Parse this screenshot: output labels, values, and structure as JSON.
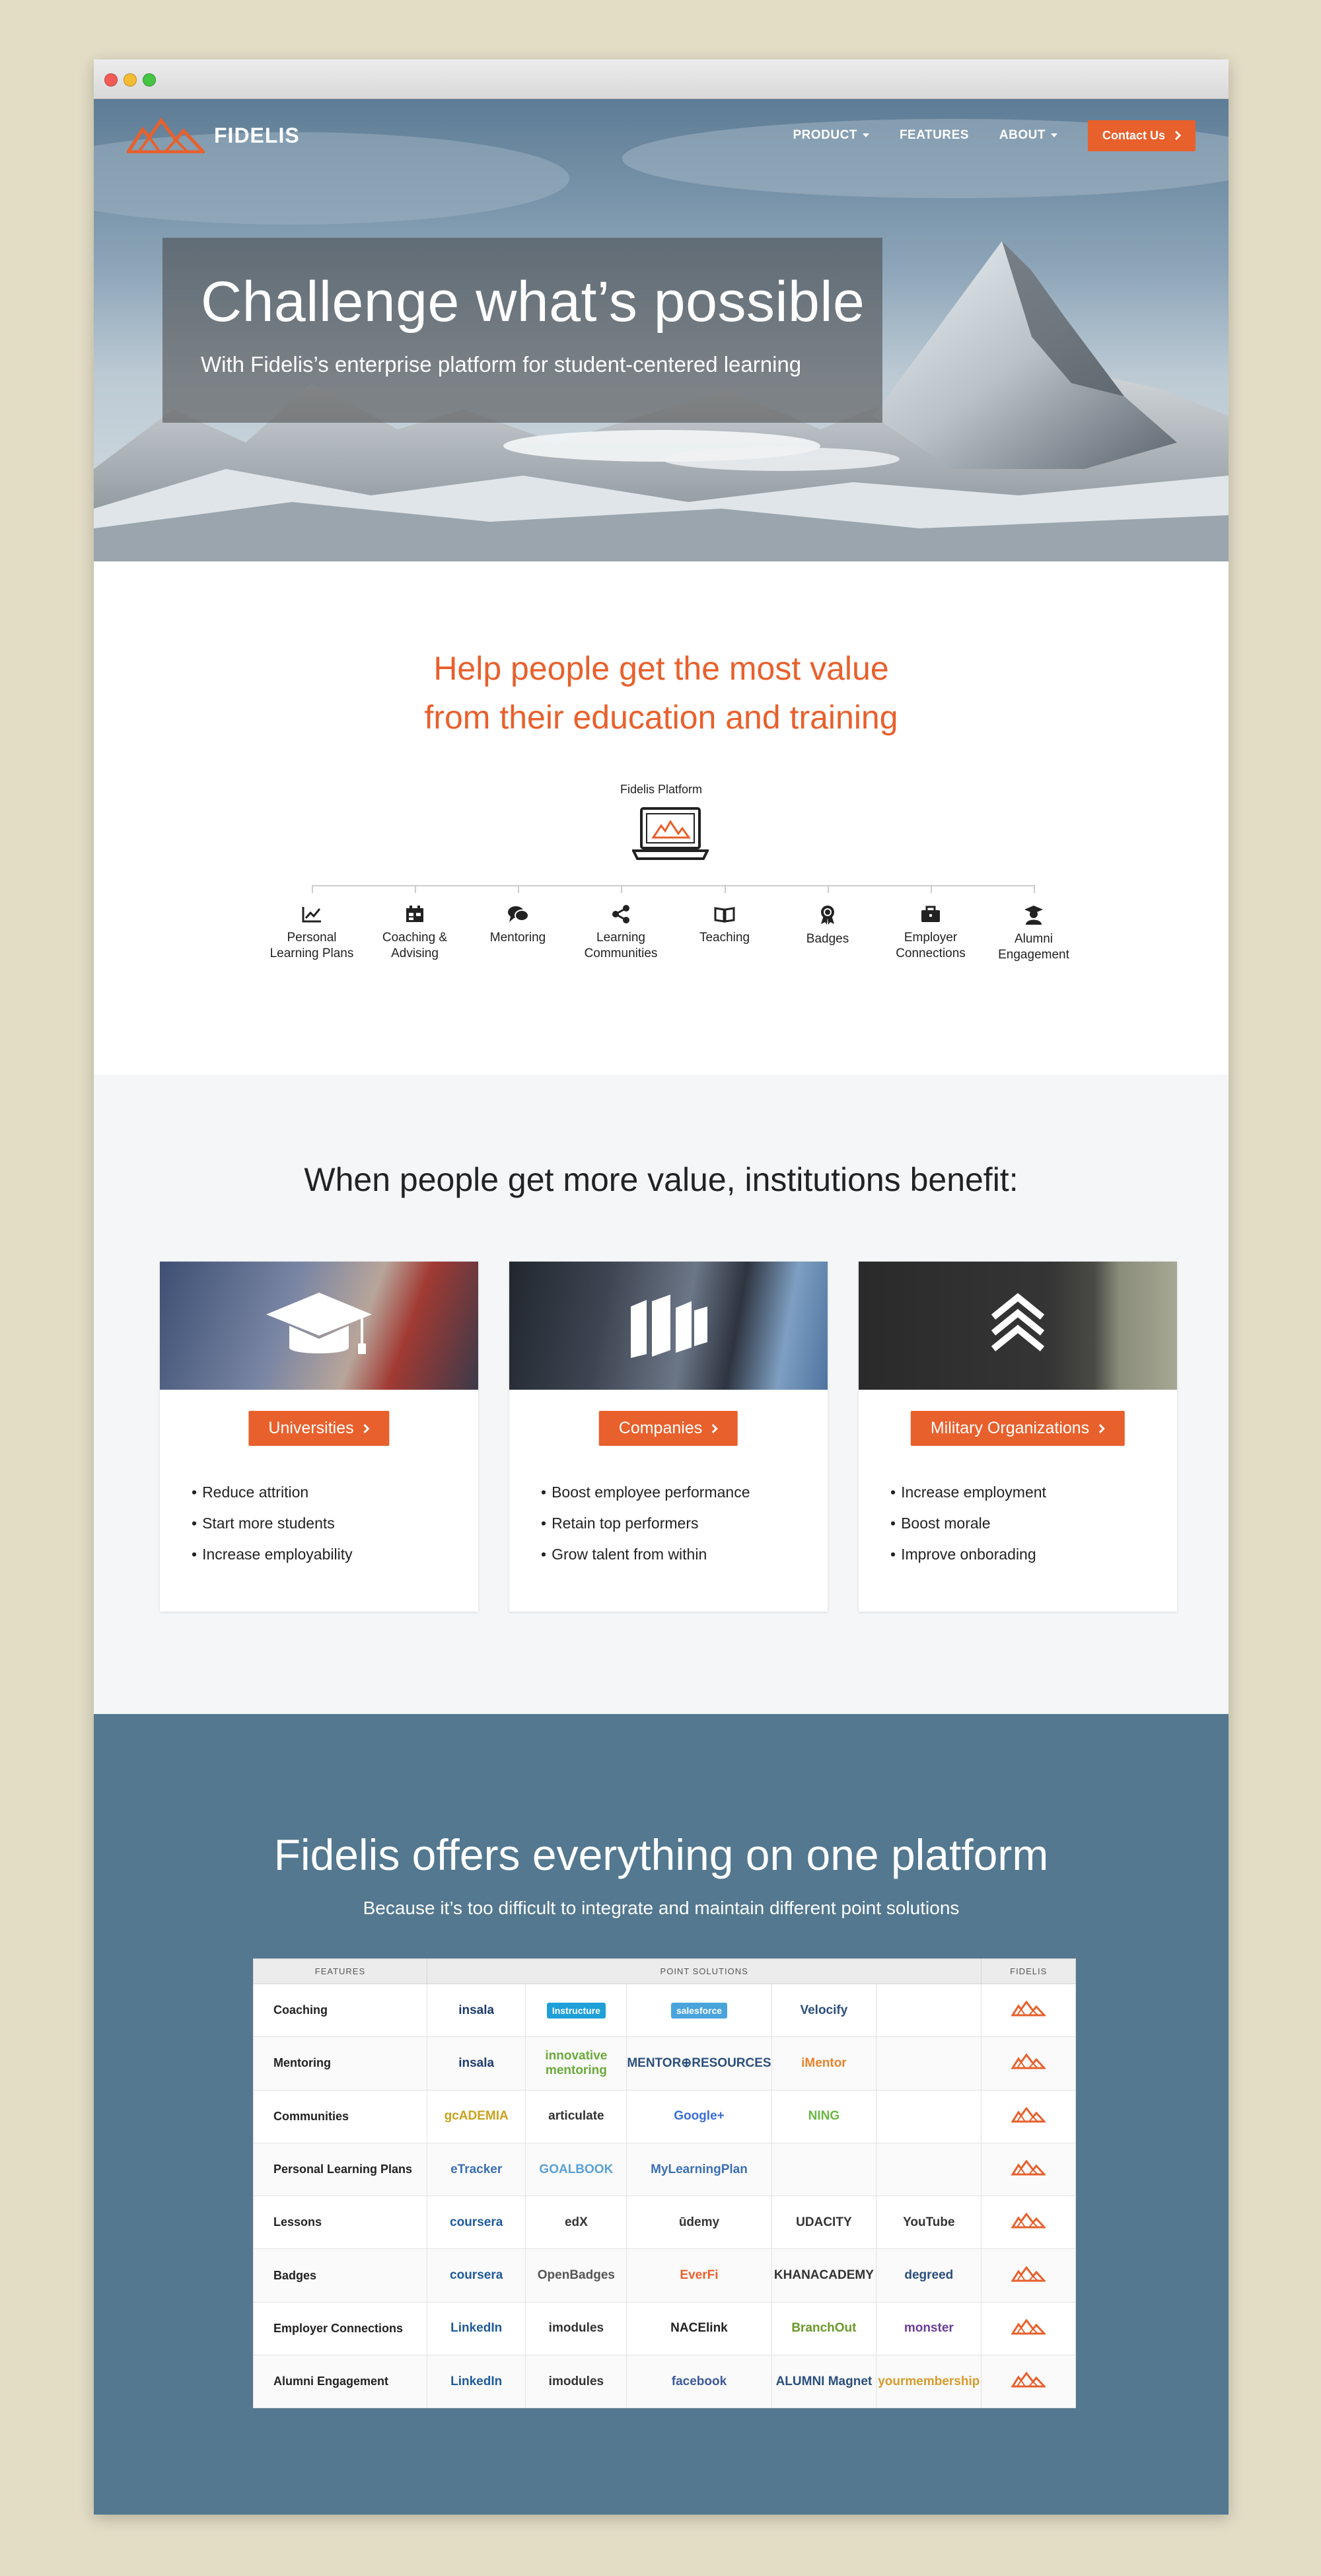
{
  "brand": {
    "name": "FIDELIS",
    "accent": "#e8602c",
    "blue": "#537890"
  },
  "nav": {
    "items": [
      {
        "label": "PRODUCT",
        "dropdown": true
      },
      {
        "label": "FEATURES",
        "dropdown": false
      },
      {
        "label": "ABOUT",
        "dropdown": true
      }
    ],
    "contact_label": "Contact Us"
  },
  "hero": {
    "title": "Challenge what’s possible",
    "subtitle": "With Fidelis’s enterprise platform for student-centered learning"
  },
  "value": {
    "title_line1": "Help people get the most value",
    "title_line2": "from their education and training",
    "platform_label": "Fidelis Platform",
    "features": [
      {
        "label1": "Personal",
        "label2": "Learning Plans",
        "icon": "chart-icon"
      },
      {
        "label1": "Coaching &",
        "label2": "Advising",
        "icon": "calendar-icon"
      },
      {
        "label1": "Mentoring",
        "label2": "",
        "icon": "chat-icon"
      },
      {
        "label1": "Learning",
        "label2": "Communities",
        "icon": "share-icon"
      },
      {
        "label1": "Teaching",
        "label2": "",
        "icon": "book-icon"
      },
      {
        "label1": "Badges",
        "label2": "",
        "icon": "badge-icon"
      },
      {
        "label1": "Employer",
        "label2": "Connections",
        "icon": "briefcase-icon"
      },
      {
        "label1": "Alumni",
        "label2": "Engagement",
        "icon": "graduate-icon"
      }
    ]
  },
  "benefits": {
    "title": "When people get more value, institutions benefit:",
    "cards": [
      {
        "button": "Universities",
        "icon": "graduation-cap-icon",
        "bullets": [
          "Reduce attrition",
          "Start more students",
          "Increase employability"
        ]
      },
      {
        "button": "Companies",
        "icon": "buildings-icon",
        "bullets": [
          "Boost employee performance",
          "Retain top performers",
          "Grow talent from within"
        ]
      },
      {
        "button": "Military Organizations",
        "icon": "chevron-rank-icon",
        "bullets": [
          "Increase employment",
          "Boost morale",
          "Improve onborading"
        ]
      }
    ]
  },
  "platform": {
    "title": "Fidelis offers everything on one platform",
    "subtitle": "Because it’s too difficult to integrate and maintain different point solutions",
    "headers": {
      "features": "FEATURES",
      "point": "POINT SOLUTIONS",
      "fidelis": "FIDELIS"
    },
    "rows": [
      {
        "feature": "Coaching",
        "solutions": [
          {
            "name": "insala",
            "color": "#1e3b6e"
          },
          {
            "name": "Instructure",
            "color": "#ffffff",
            "bg": "#1fa0d8"
          },
          {
            "name": "salesforce",
            "color": "#ffffff",
            "bg": "#4aa4dc"
          },
          {
            "name": "Velocify",
            "color": "#2b4f7d"
          },
          {
            "name": "",
            "color": "#222222"
          }
        ]
      },
      {
        "feature": "Mentoring",
        "solutions": [
          {
            "name": "insala",
            "color": "#1e3b6e"
          },
          {
            "name": "innovative mentoring",
            "color": "#6aaa3a"
          },
          {
            "name": "MENTOR⊕RESOURCES",
            "color": "#2b4f7d"
          },
          {
            "name": "iMentor",
            "color": "#e8822c"
          },
          {
            "name": "",
            "color": "#222222"
          }
        ]
      },
      {
        "feature": "Communities",
        "solutions": [
          {
            "name": "gcADEMIA",
            "color": "#c9a21c"
          },
          {
            "name": "articulate",
            "color": "#333333"
          },
          {
            "name": "Google+",
            "color": "#3b6fd4"
          },
          {
            "name": "NING",
            "color": "#6ab843"
          },
          {
            "name": "",
            "color": "#222222"
          }
        ]
      },
      {
        "feature": "Personal Learning Plans",
        "solutions": [
          {
            "name": "eTracker",
            "color": "#3b6fb4"
          },
          {
            "name": "GOALBOOK",
            "color": "#5aa0d8"
          },
          {
            "name": "MyLearningPlan",
            "color": "#3b6fb4"
          },
          {
            "name": "",
            "color": "#222222"
          },
          {
            "name": "",
            "color": "#222222"
          }
        ]
      },
      {
        "feature": "Lessons",
        "solutions": [
          {
            "name": "coursera",
            "color": "#1e5a9c"
          },
          {
            "name": "edX",
            "color": "#333333"
          },
          {
            "name": "ūdemy",
            "color": "#333333"
          },
          {
            "name": "UDACITY",
            "color": "#333333"
          },
          {
            "name": "YouTube",
            "color": "#333333"
          }
        ]
      },
      {
        "feature": "Badges",
        "solutions": [
          {
            "name": "coursera",
            "color": "#1e5a9c"
          },
          {
            "name": "OpenBadges",
            "color": "#555555"
          },
          {
            "name": "EverFi",
            "color": "#e8602c"
          },
          {
            "name": "KHANACADEMY",
            "color": "#333333"
          },
          {
            "name": "degreed",
            "color": "#2b4f7d"
          }
        ]
      },
      {
        "feature": "Employer Connections",
        "solutions": [
          {
            "name": "LinkedIn",
            "color": "#1e5a9c"
          },
          {
            "name": "imodules",
            "color": "#333333"
          },
          {
            "name": "NACElink",
            "color": "#222222"
          },
          {
            "name": "BranchOut",
            "color": "#6a9a2a"
          },
          {
            "name": "monster",
            "color": "#6a3b9c"
          }
        ]
      },
      {
        "feature": "Alumni Engagement",
        "solutions": [
          {
            "name": "LinkedIn",
            "color": "#1e5a9c"
          },
          {
            "name": "imodules",
            "color": "#333333"
          },
          {
            "name": "facebook",
            "color": "#3b5998"
          },
          {
            "name": "ALUMNI Magnet",
            "color": "#2b4f7d"
          },
          {
            "name": "yourmembership",
            "color": "#d89a2c"
          }
        ]
      }
    ]
  }
}
